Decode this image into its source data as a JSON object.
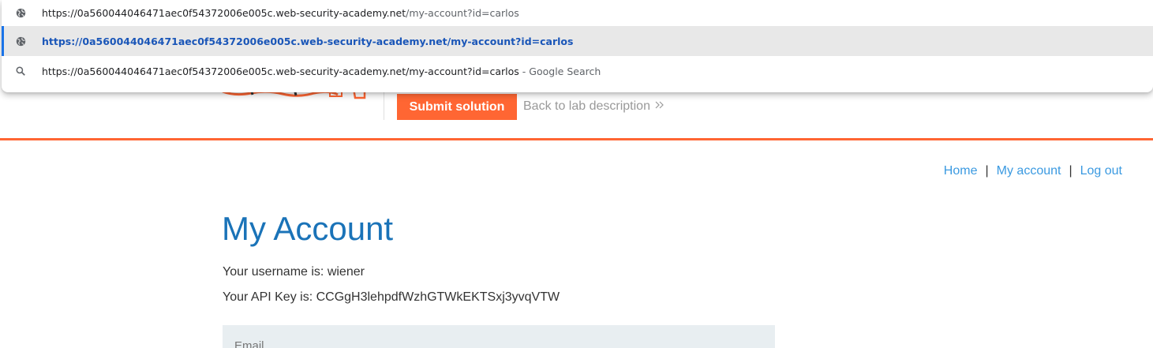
{
  "omnibox": {
    "suggestions": [
      {
        "icon": "globe-icon",
        "host": "https://0a560044046471aec0f54372006e005c.web-security-academy.net",
        "path": "/my-account?id=carlos"
      },
      {
        "icon": "globe-icon",
        "url": "https://0a560044046471aec0f54372006e005c.web-security-academy.net/my-account?id=carlos"
      },
      {
        "icon": "search-icon",
        "query": "https://0a560044046471aec0f54372006e005c.web-security-academy.net/my-account?id=carlos",
        "suffix": "- Google Search"
      }
    ]
  },
  "header": {
    "submit_label": "Submit solution",
    "back_label": "Back to lab description"
  },
  "nav": {
    "home": "Home",
    "account": "My account",
    "logout": "Log out",
    "separator": "|"
  },
  "main": {
    "title": "My Account",
    "username_line": "Your username is: wiener",
    "api_key_line": "Your API Key is: CCGgH3lehpdfWzhGTWkEKTSxj3yvqVTW",
    "email_placeholder": "Email"
  },
  "colors": {
    "accent": "#ff6633",
    "link": "#3b9ae1",
    "title": "#1a73b8"
  }
}
